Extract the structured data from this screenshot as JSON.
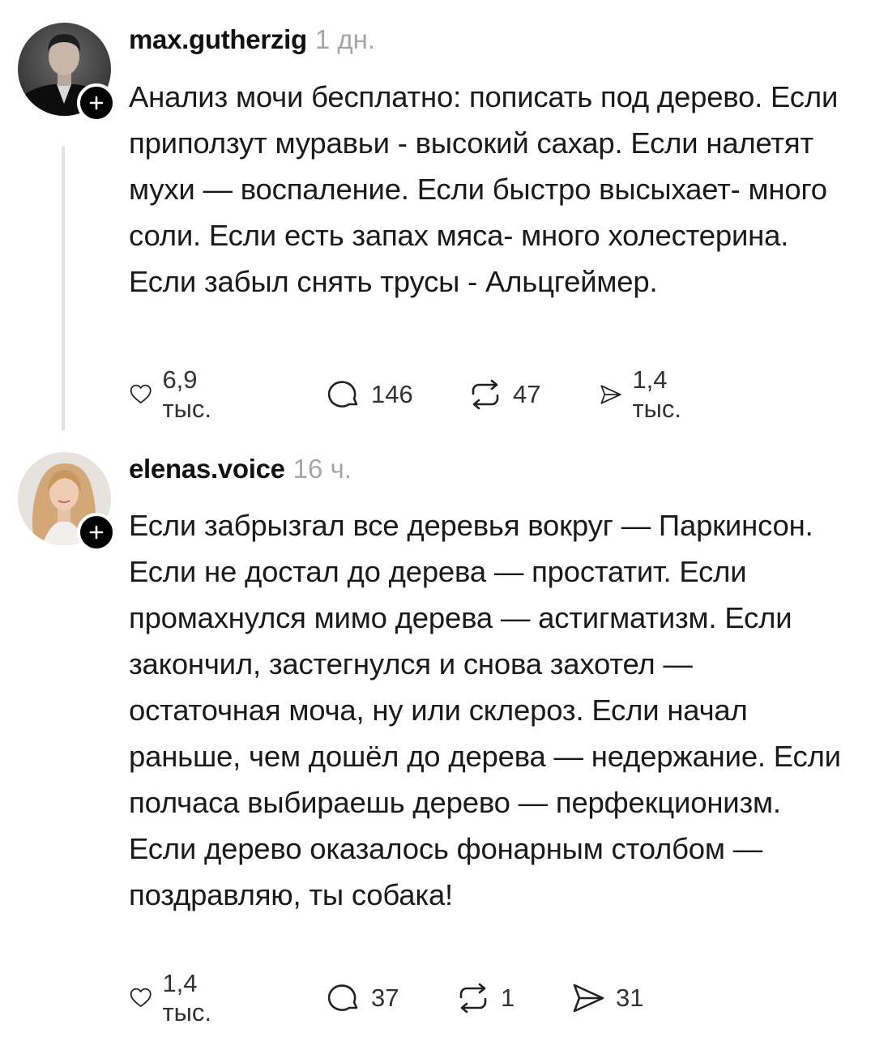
{
  "posts": [
    {
      "username": "max.gutherzig",
      "time": "1 дн.",
      "text": "Анализ мочи бесплатно: пописать под дерево. Если приползут муравьи - высокий сахар. Если налетят мухи — воспаление. Если быстро высыхает- много соли. Если есть запах мяса- много холестерина. Если забыл снять трусы - Альцгеймер.",
      "likes": "6,9 тыс.",
      "comments": "146",
      "reposts": "47",
      "shares": "1,4 тыс."
    },
    {
      "username": "elenas.voice",
      "time": "16 ч.",
      "text": "Если забрызгал все деревья вокруг — Паркинсон. Если не достал до дерева — простатит.  Если промахнулся мимо дерева — астигматизм.  Если закончил, застегнулся и снова захотел — остаточная моча, ну или склероз. Если начал раньше, чем дошёл до дерева — недержание. Если полчаса выбираешь дерево — перфекционизм. Если дерево оказалось фонарным столбом — поздравляю, ты собака!",
      "likes": "1,4 тыс.",
      "comments": "37",
      "reposts": "1",
      "shares": "31"
    }
  ],
  "icons": {
    "like": "heart-icon",
    "comment": "comment-bubble-icon",
    "repost": "repost-icon",
    "share": "send-icon",
    "follow": "plus-icon"
  }
}
